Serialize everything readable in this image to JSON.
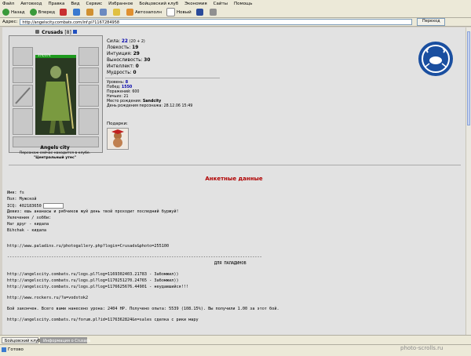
{
  "menu": [
    "Файл",
    "Автовход",
    "Правка",
    "Вид",
    "Сервис",
    "Избранное",
    "Бойцовский клуб",
    "Экономия",
    "Сайты",
    "Помощь"
  ],
  "toolbar": {
    "back": "Назад",
    "forward": "Вперед",
    "autofill": "Автозаполн",
    "new": "Новый"
  },
  "address": {
    "label": "Адрес:",
    "url": "http://angelscity.combats.com/inf.pl?1167284958",
    "go": "Переход"
  },
  "character": {
    "name": "Crusads",
    "level": "[8]",
    "hp": "374/374",
    "city": "Angels city",
    "location_line1": "Персонаж сейчас находится в клубе.",
    "location_line2": "\"Центральный утес\""
  },
  "stats": [
    {
      "label": "Сила:",
      "value": "22",
      "extra": "(20 + 2)"
    },
    {
      "label": "Ловкость:",
      "value": "19",
      "extra": ""
    },
    {
      "label": "Интуиция:",
      "value": "29",
      "extra": ""
    },
    {
      "label": "Выносливость:",
      "value": "30",
      "extra": ""
    },
    {
      "label": "Интеллект:",
      "value": "0",
      "extra": ""
    },
    {
      "label": "Мудрость:",
      "value": "0",
      "extra": ""
    }
  ],
  "info": [
    {
      "label": "Уровень:",
      "value": "8"
    },
    {
      "label": "Побед:",
      "value": "1550"
    },
    {
      "label": "Поражений:",
      "value": "600"
    },
    {
      "label": "Ничьих:",
      "value": "21"
    },
    {
      "label": "Место рождения:",
      "value": "Sandcity"
    },
    {
      "label": "День рождения персонажа:",
      "value": "28.12.06 15:49"
    }
  ],
  "gifts_label": "Подарки:",
  "profile": {
    "title": "Анкетные данные",
    "name": "Имя: fs",
    "gender": "Пол: Мужской",
    "icq": "ICQ: 402183650",
    "motto": "Девиз: ешь ананасы и рябчиков жуй день твой проходит последний буржуй!",
    "hobbies": "Увлечения / хобби:",
    "line1": "Наг друг - кидала",
    "line2": "Bihchak - кидала",
    "url1": "http://www.paladins.ru/photogallery.php?login=Crusads&photo=255100",
    "dashes": "--------------------------------------------------------------------------------------------------------",
    "paladins": "ДЛЯ ПАЛАДИНОВ",
    "log1": "http://angelscity.combats.ru/logs.pl?log=1169302403.21783 - Забомжил))",
    "log2": "http://angelscity.combats.ru/logs.pl?log=1170251270.24765 - Забомжил))",
    "log3": "http://angelscity.combats.ru/logs.pl?log=1176625676.44901 - неудавшийся!!!",
    "url2": "http://www.rockers.ru/?a=vodstok2",
    "battle": "Бой закончен. Всего вами нанесено урона: 2404 HP. Получено опыта: 5539 (108.15%). Вы получили 1.00 за этот бой.",
    "forum": "http://angelscity.combats.ru/forum.pl?id=1176362824&n=sales сделка с рики мару"
  },
  "tasks": [
    "Бойцовский клуб",
    "Информация о Crusads"
  ],
  "status": "Готово",
  "watermark": "photo-scrolls.ru",
  "colors": {
    "title_red": "#b00000",
    "hp_green": "#1e9a1e",
    "logo_blue": "#1a4fa0"
  }
}
